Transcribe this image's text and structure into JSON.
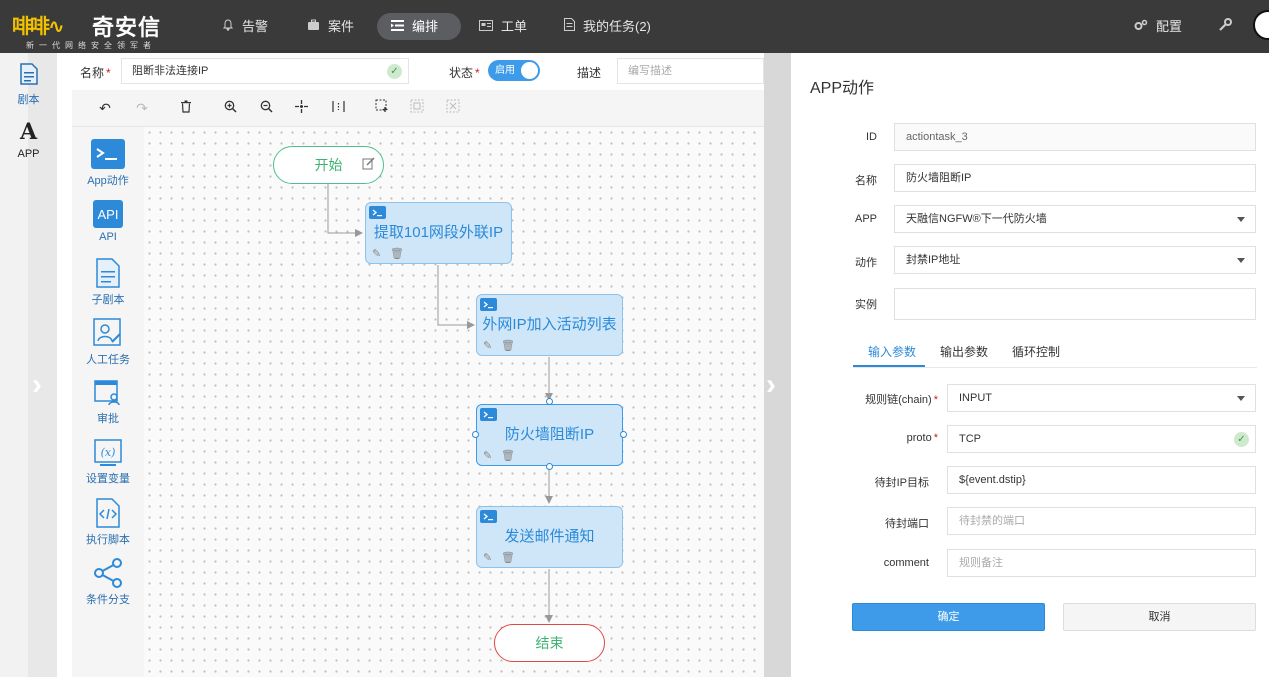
{
  "app": {
    "logo_glyphs": "啡啡∿",
    "logo_name": "奇安信",
    "logo_slogan": "新一代网络安全领军者"
  },
  "nav": {
    "items": [
      {
        "label": "告警",
        "icon": "bell-icon"
      },
      {
        "label": "案件",
        "icon": "briefcase-icon"
      },
      {
        "label": "编排",
        "icon": "playbook-icon"
      },
      {
        "label": "工单",
        "icon": "ticket-icon"
      },
      {
        "label": "我的任务(2)",
        "icon": "task-icon"
      }
    ],
    "active": "编排",
    "config_label": "配置",
    "accent": "#5b5d60"
  },
  "sidebar": {
    "items": [
      {
        "label": "剧本",
        "icon": "document-icon"
      },
      {
        "label": "APP",
        "icon": "app-letter-icon",
        "glyph": "A"
      }
    ]
  },
  "form": {
    "name_label": "名称",
    "name_value": "阻断非法连接IP",
    "status_label": "状态",
    "status_value": "启用",
    "desc_label": "描述",
    "desc_placeholder": "编写描述"
  },
  "palette": {
    "items": [
      {
        "label": "App动作",
        "icon": "terminal-icon"
      },
      {
        "label": "API",
        "icon": "api-icon"
      },
      {
        "label": "子剧本",
        "icon": "subplaybook-icon"
      },
      {
        "label": "人工任务",
        "icon": "manual-task-icon"
      },
      {
        "label": "审批",
        "icon": "approval-icon"
      },
      {
        "label": "设置变量",
        "icon": "variable-icon"
      },
      {
        "label": "执行脚本",
        "icon": "script-icon"
      },
      {
        "label": "条件分支",
        "icon": "branch-icon"
      }
    ]
  },
  "flow": {
    "start": "开始",
    "end": "结束",
    "nodes": [
      {
        "title": "提取101网段外联IP"
      },
      {
        "title": "外网IP加入活动列表"
      },
      {
        "title": "防火墙阻断IP"
      },
      {
        "title": "发送邮件通知"
      }
    ]
  },
  "panel": {
    "title": "APP动作",
    "fields": [
      {
        "label": "ID",
        "value": "actiontask_3"
      },
      {
        "label": "名称",
        "value": "防火墙阻断IP"
      },
      {
        "label": "APP",
        "value": "天融信NGFW®下一代防火墙"
      },
      {
        "label": "动作",
        "value": "封禁IP地址"
      },
      {
        "label": "实例",
        "value": ""
      }
    ],
    "tabs": [
      "输入参数",
      "输出参数",
      "循环控制"
    ],
    "active_tab": "输入参数",
    "params": [
      {
        "label": "规则链(chain)",
        "value": "INPUT",
        "required": true
      },
      {
        "label": "proto",
        "value": "TCP",
        "required": true
      },
      {
        "label": "待封IP目标",
        "value": "${event.dstip}"
      },
      {
        "label": "待封端口",
        "placeholder": "待封禁的端口"
      },
      {
        "label": "comment",
        "placeholder": "规则备注"
      }
    ],
    "ok_label": "确定",
    "cancel_label": "取消",
    "primary_color": "#3d9be9"
  }
}
